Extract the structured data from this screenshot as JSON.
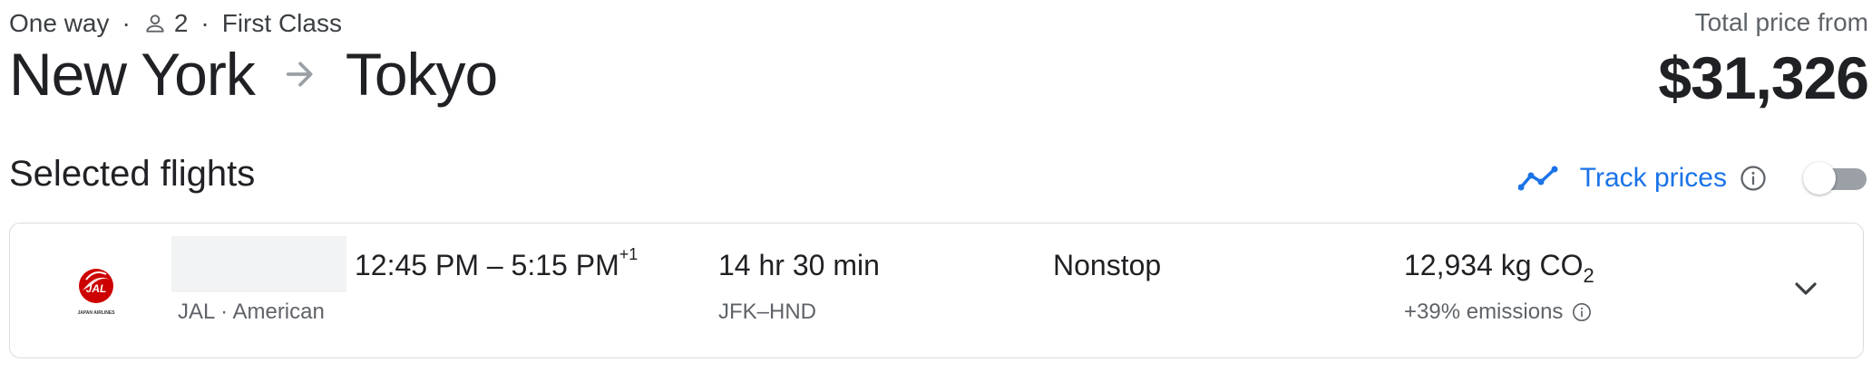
{
  "header": {
    "trip_type": "One way",
    "passengers": "2",
    "cabin_class": "First Class",
    "origin": "New York",
    "destination": "Tokyo",
    "price_label": "Total price from",
    "price": "$31,326"
  },
  "selected_flights": {
    "title": "Selected flights",
    "track_prices_label": "Track prices",
    "track_prices_enabled": false
  },
  "flight": {
    "times": "12:45 PM – 5:15 PM",
    "day_offset": "+1",
    "airlines": "JAL · American",
    "duration": "14 hr 30 min",
    "airports": "JFK–HND",
    "stops": "Nonstop",
    "emissions_value": "12,934 kg CO",
    "emissions_subscript": "2",
    "emissions_delta": "+39% emissions",
    "logo_text": "JAL",
    "logo_caption": "JAPAN AIRLINES"
  },
  "colors": {
    "accent": "#1a73e8",
    "jal_red": "#cc0000",
    "toggle_off": "#9aa0a6",
    "border": "#dadce0"
  },
  "icons": {
    "passenger": "person-icon",
    "route_arrow": "arrow-right-icon",
    "track": "trend-line-icon",
    "info": "info-icon",
    "expand": "chevron-down-icon"
  }
}
